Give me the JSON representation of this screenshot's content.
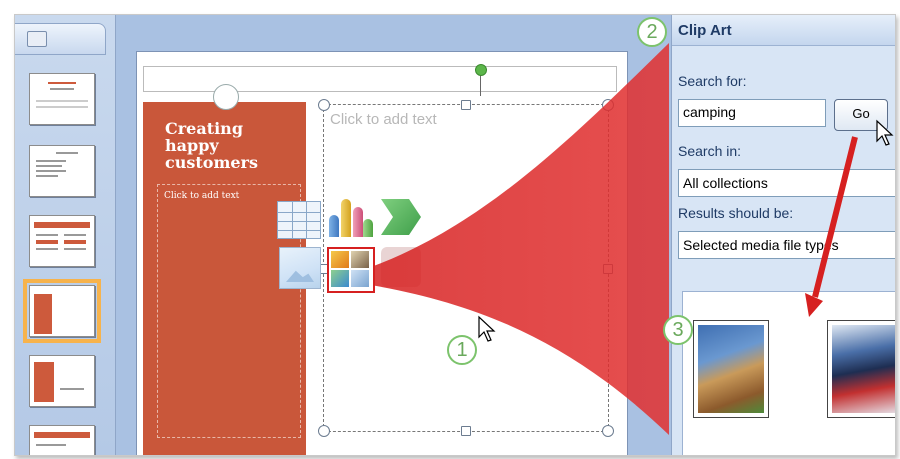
{
  "slide": {
    "title": "Creating happy customers",
    "left_text_placeholder": "Click to add text",
    "content_placeholder": "Click to add text"
  },
  "clip_art_pane": {
    "title": "Clip Art",
    "search_for_label": "Search for:",
    "search_value": "camping",
    "go_label": "Go",
    "search_in_label": "Search in:",
    "search_in_value": "All collections",
    "results_label": "Results should be:",
    "results_value": "Selected media file types"
  },
  "callouts": [
    "1",
    "2",
    "3"
  ],
  "icons": {
    "insert_table": "table-icon",
    "insert_chart": "chart-icon",
    "insert_smartart": "smartart-icon",
    "insert_picture": "picture-icon",
    "insert_clip_art": "clip-art-icon",
    "insert_media": "media-icon"
  },
  "colors": {
    "slide_accent": "#c9573a",
    "callout_red": "#d62020",
    "callout_ring": "#7cc36c",
    "pane_bg": "#d8e5f5"
  }
}
